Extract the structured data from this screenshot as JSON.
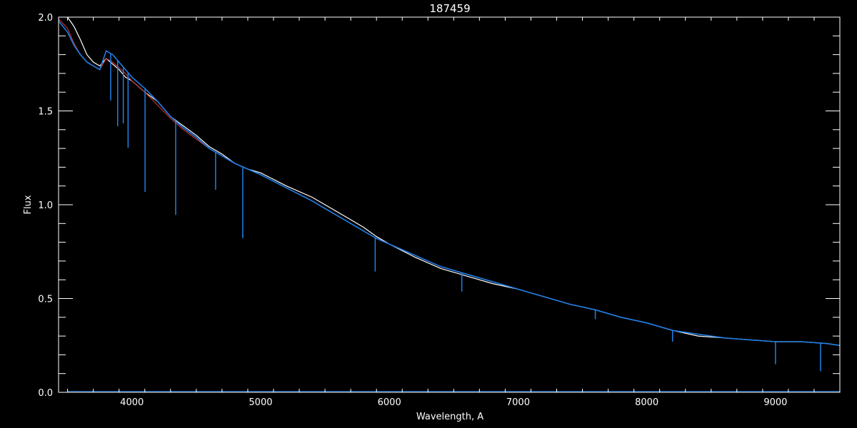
{
  "chart_data": {
    "type": "line",
    "title": "187459",
    "xlabel": "Wavelength, A",
    "ylabel": "Flux",
    "xlim": [
      3430,
      9500
    ],
    "ylim": [
      0.0,
      2.0
    ],
    "x_ticks": [
      4000,
      5000,
      6000,
      7000,
      8000,
      9000
    ],
    "x_tick_labels": [
      "4000",
      "5000",
      "6000",
      "7000",
      "8000",
      "9000"
    ],
    "y_ticks": [
      0.0,
      0.5,
      1.0,
      1.5,
      2.0
    ],
    "y_tick_labels": [
      "0.0",
      "0.5",
      "1.0",
      "1.5",
      "2.0"
    ],
    "grid": false,
    "colors": {
      "background": "#000000",
      "axes": "#ffffff",
      "observed": "#ffffff",
      "model": "#c03030",
      "fit": "#1e7fe6"
    },
    "series": [
      {
        "color_key": "observed",
        "x": [
          3430,
          3500,
          3550,
          3600,
          3650,
          3700,
          3750,
          3800,
          3850,
          3900,
          3950,
          4000,
          4100,
          4200,
          4300,
          4400,
          4500,
          4600,
          4700,
          4800,
          4900,
          5000,
          5200,
          5400,
          5500,
          5600,
          5700,
          5800,
          5900,
          6000,
          6200,
          6400,
          6600,
          6800,
          7000,
          7200,
          7400,
          7600,
          7800,
          8000,
          8200,
          8400,
          8600,
          8800,
          9000,
          9200,
          9400,
          9500
        ],
        "y": [
          2.02,
          2.0,
          1.95,
          1.88,
          1.8,
          1.76,
          1.74,
          1.78,
          1.75,
          1.72,
          1.68,
          1.66,
          1.6,
          1.55,
          1.47,
          1.42,
          1.37,
          1.31,
          1.27,
          1.22,
          1.19,
          1.17,
          1.1,
          1.04,
          1.0,
          0.96,
          0.92,
          0.88,
          0.83,
          0.79,
          0.72,
          0.66,
          0.62,
          0.58,
          0.55,
          0.51,
          0.47,
          0.44,
          0.4,
          0.37,
          0.33,
          0.3,
          0.29,
          0.28,
          0.27,
          0.27,
          0.26,
          0.25
        ]
      },
      {
        "color_key": "model",
        "x": [
          3430,
          3500,
          3550,
          3600,
          3650,
          3700,
          3750,
          3800,
          3850,
          3900,
          3950,
          4000,
          4100,
          4200,
          4300,
          4400,
          4500,
          4600,
          4700,
          4800,
          4900,
          5000,
          5200,
          5400,
          5500,
          5600,
          5700,
          5800,
          5900,
          6000,
          6200,
          6400,
          6600,
          6800,
          7000,
          7200,
          7400,
          7600,
          7800,
          8000,
          8200,
          8400,
          8600,
          8800,
          9000,
          9200,
          9400,
          9500
        ],
        "y": [
          1.99,
          1.94,
          1.86,
          1.8,
          1.76,
          1.74,
          1.72,
          1.78,
          1.76,
          1.73,
          1.7,
          1.66,
          1.6,
          1.53,
          1.46,
          1.4,
          1.35,
          1.3,
          1.26,
          1.22,
          1.19,
          1.16,
          1.09,
          1.02,
          0.98,
          0.94,
          0.9,
          0.86,
          0.82,
          0.79,
          0.73,
          0.67,
          0.63,
          0.59,
          0.55,
          0.51,
          0.47,
          0.44,
          0.4,
          0.37,
          0.33,
          0.31,
          0.29,
          0.28,
          0.27,
          0.27,
          0.26,
          0.25
        ]
      },
      {
        "color_key": "fit",
        "x": [
          3430,
          3500,
          3550,
          3600,
          3650,
          3700,
          3750,
          3800,
          3850,
          3900,
          3950,
          4000,
          4100,
          4200,
          4300,
          4400,
          4500,
          4600,
          4700,
          4800,
          4900,
          5000,
          5200,
          5400,
          5500,
          5600,
          5700,
          5800,
          5900,
          6000,
          6200,
          6400,
          6600,
          6800,
          7000,
          7200,
          7400,
          7600,
          7800,
          8000,
          8200,
          8400,
          8600,
          8800,
          9000,
          9200,
          9400,
          9500
        ],
        "y": [
          1.98,
          1.92,
          1.85,
          1.8,
          1.76,
          1.74,
          1.72,
          1.82,
          1.8,
          1.76,
          1.72,
          1.68,
          1.62,
          1.55,
          1.47,
          1.41,
          1.36,
          1.3,
          1.26,
          1.22,
          1.19,
          1.16,
          1.09,
          1.02,
          0.98,
          0.94,
          0.9,
          0.86,
          0.82,
          0.79,
          0.73,
          0.67,
          0.63,
          0.59,
          0.55,
          0.51,
          0.47,
          0.44,
          0.4,
          0.37,
          0.33,
          0.31,
          0.29,
          0.28,
          0.27,
          0.27,
          0.26,
          0.25
        ]
      }
    ],
    "absorption_lines": [
      {
        "x": 3835,
        "depth": 0.25
      },
      {
        "x": 3889,
        "depth": 0.35
      },
      {
        "x": 3933,
        "depth": 0.3
      },
      {
        "x": 3970,
        "depth": 0.4
      },
      {
        "x": 4102,
        "depth": 0.55
      },
      {
        "x": 4340,
        "depth": 0.5
      },
      {
        "x": 4650,
        "depth": 0.2
      },
      {
        "x": 4861,
        "depth": 0.38
      },
      {
        "x": 5890,
        "depth": 0.18
      },
      {
        "x": 6563,
        "depth": 0.1
      },
      {
        "x": 7600,
        "depth": 0.05
      },
      {
        "x": 8200,
        "depth": 0.06
      },
      {
        "x": 9000,
        "depth": 0.12
      },
      {
        "x": 9350,
        "depth": 0.15
      }
    ]
  }
}
